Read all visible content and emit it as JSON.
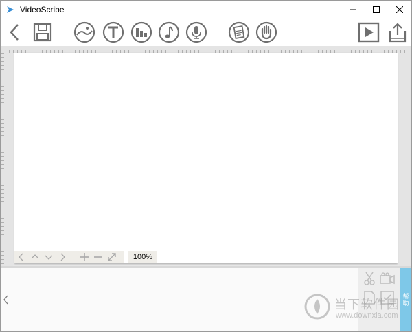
{
  "window": {
    "title": "VideoScribe",
    "logo_icon": "videoscribe-logo-icon",
    "controls": [
      "minimize-icon",
      "maximize-icon",
      "close-icon"
    ]
  },
  "toolbar": {
    "items": [
      {
        "name": "back",
        "icon": "chevron-left-icon"
      },
      {
        "name": "save",
        "icon": "floppy-disk-icon"
      },
      {
        "name": "add-image",
        "icon": "image-icon"
      },
      {
        "name": "add-text",
        "icon": "text-t-icon"
      },
      {
        "name": "add-chart",
        "icon": "bar-chart-icon"
      },
      {
        "name": "add-music",
        "icon": "music-note-icon"
      },
      {
        "name": "add-voiceover",
        "icon": "microphone-icon"
      },
      {
        "name": "background",
        "icon": "paper-icon"
      },
      {
        "name": "hand",
        "icon": "hand-icon"
      },
      {
        "name": "play",
        "icon": "play-icon"
      },
      {
        "name": "publish",
        "icon": "upload-icon"
      }
    ]
  },
  "canvas": {
    "zoom": "100%",
    "nav_icons": [
      "chevron-left-icon",
      "chevron-up-icon",
      "chevron-down-icon",
      "chevron-right-icon",
      "plus-icon",
      "minus-icon",
      "expand-icon"
    ]
  },
  "timeline": {
    "tab_label": "帮助",
    "tools": [
      "scissors-icon",
      "camera-icon",
      "document-icon",
      "checklist-icon"
    ]
  },
  "watermark": {
    "text": "当下软件园",
    "url": "www.downxia.com"
  },
  "colors": {
    "icon_gray": "#6f6f6f",
    "tab_blue": "#7ec8e8",
    "canvas_bg": "#ffffff",
    "workspace_bg": "#e6e6e6"
  }
}
